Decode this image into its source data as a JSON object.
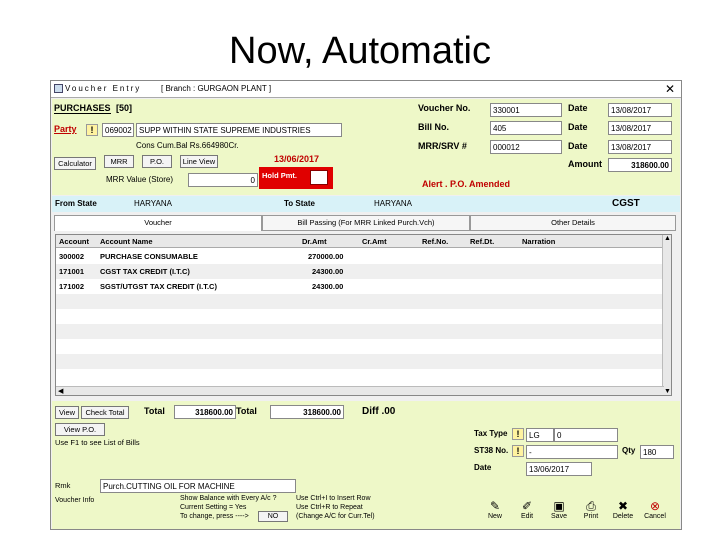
{
  "slide": {
    "title": "Now, Automatic"
  },
  "window": {
    "title": "Voucher Entry",
    "branch": "[ Branch : GURGAON PLANT ]",
    "close_glyph": "✕"
  },
  "header": {
    "purchases_label": "PURCHASES",
    "purchases_code": "[50]",
    "party_label": "Party",
    "party_code": "069002",
    "party_name": "SUPP WITHIN STATE SUPREME INDUSTRIES",
    "cons_balance": "Cons Cum.Bal Rs.664980Cr.",
    "calculator_btn": "Calculator",
    "mrr_btn": "MRR",
    "po_btn": "P.O.",
    "line_view_btn": "Line View",
    "date_red": "13/06/2017",
    "mrr_value_label": "MRR Value (Store)",
    "mrr_value": "0",
    "hold_pmt_label": "Hold Pmt.",
    "voucher_no_label": "Voucher No.",
    "voucher_no": "330001",
    "bill_no_label": "Bill No.",
    "bill_no": "405",
    "mrr_srv_label": "MRR/SRV #",
    "mrr_srv": "000012",
    "date_label": "Date",
    "date1": "13/08/2017",
    "date2": "13/08/2017",
    "date3": "13/08/2017",
    "amount_label": "Amount",
    "amount": "318600.00",
    "alert": "Alert . P.O. Amended"
  },
  "state_bar": {
    "from_label": "From State",
    "from_value": "HARYANA",
    "to_label": "To State",
    "to_value": "HARYANA",
    "tax_type": "CGST"
  },
  "tabs": [
    {
      "label": "Voucher"
    },
    {
      "label": "Bill Passing (For MRR Linked Purch.Vch)"
    },
    {
      "label": "Other Details"
    }
  ],
  "table": {
    "columns": [
      "Account",
      "Account Name",
      "Dr.Amt",
      "Cr.Amt",
      "Ref.No.",
      "Ref.Dt.",
      "Narration"
    ],
    "rows": [
      {
        "account": "300002",
        "name": "PURCHASE CONSUMABLE",
        "dr": "270000.00"
      },
      {
        "account": "171001",
        "name": "CGST TAX CREDIT (I.T.C)",
        "dr": "24300.00"
      },
      {
        "account": "171002",
        "name": "SGST/UTGST TAX CREDIT (I.T.C)",
        "dr": "24300.00"
      }
    ]
  },
  "footer": {
    "view_btn": "View",
    "check_total_btn": "Check Total",
    "total_label1": "Total",
    "total_value1": "318600.00",
    "total_label2": "Total",
    "total_value2": "318600.00",
    "diff": "Diff .00",
    "view_po_btn": "View P.O.",
    "f1_hint": "Use F1 to see List of Bills",
    "tax_type_label": "Tax Type",
    "tax_type_code": "LG",
    "tax_type_value": "0",
    "st38_label": "ST38 No.",
    "st38_value": "-",
    "qty_label": "Qty",
    "qty_value": "180",
    "date_label": "Date",
    "date_value": "13/06/2017",
    "rmk_label": "Rmk",
    "rmk_value": "Purch.CUTTING OIL FOR MACHINE",
    "voucher_info": "Voucher Info",
    "show_balance": "Show Balance with Every A/c ?",
    "current_setting": "Current Setting = Yes",
    "to_change": "To change, press ---->",
    "no_btn": "NO",
    "ctrl_i": "Use Ctrl+I to Insert Row",
    "ctrl_r": "Use Ctrl+R to Repeat",
    "change_ac": "(Change A/C for Curr.Tel)",
    "actions": [
      {
        "label": "New",
        "icon": "✎"
      },
      {
        "label": "Edit",
        "icon": "✐"
      },
      {
        "label": "Save",
        "icon": "▣"
      },
      {
        "label": "Print",
        "icon": "⎙"
      },
      {
        "label": "Delete",
        "icon": "✖"
      },
      {
        "label": "Cancel",
        "icon": "⊗"
      }
    ]
  }
}
